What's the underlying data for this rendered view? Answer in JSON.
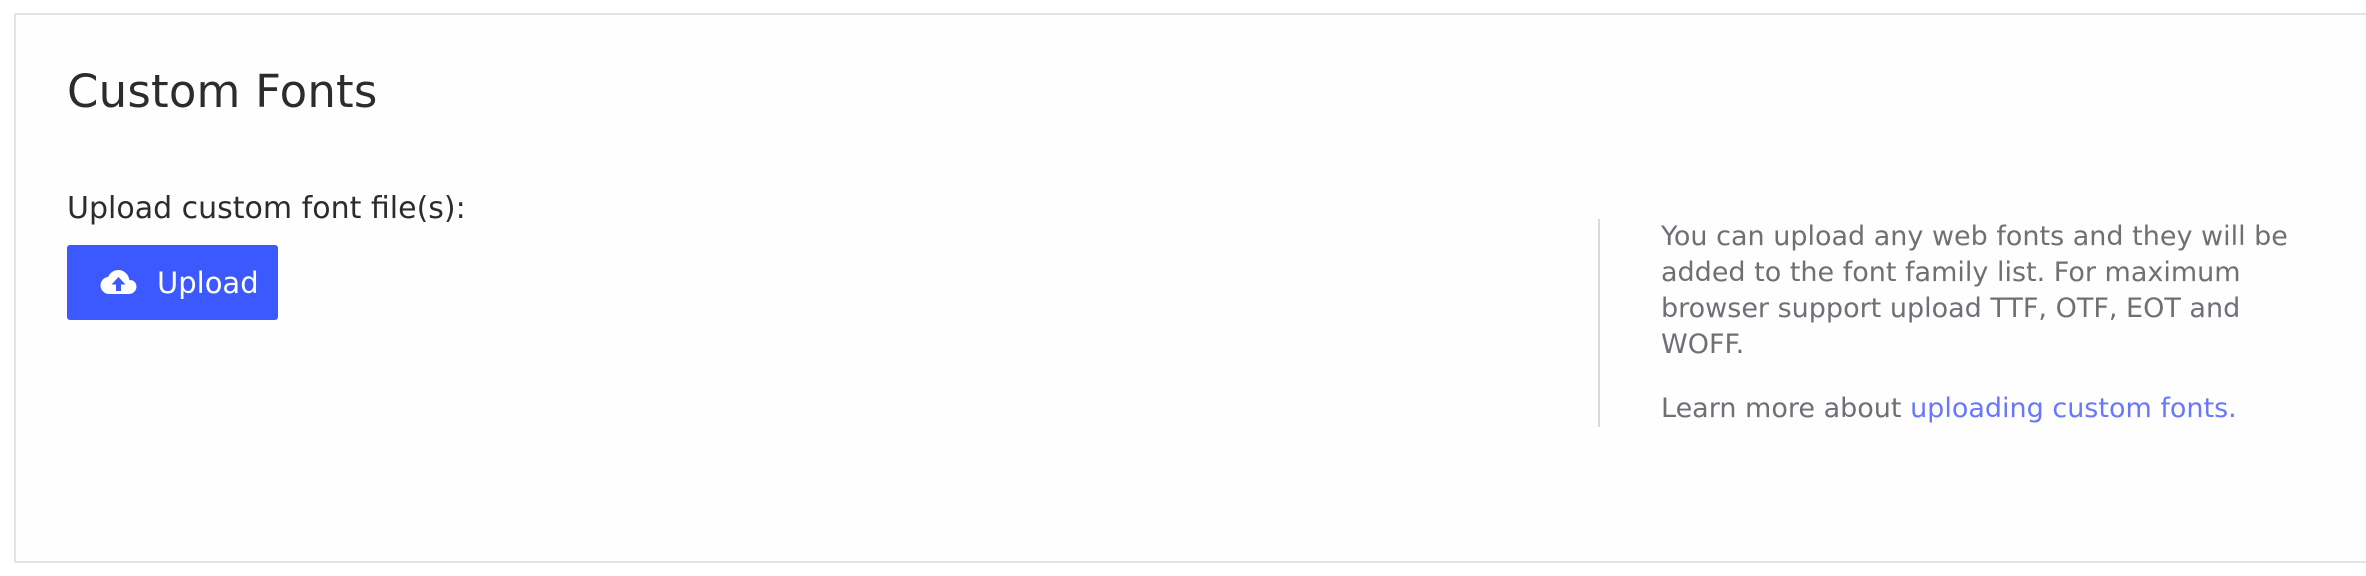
{
  "section": {
    "title": "Custom Fonts"
  },
  "upload": {
    "label": "Upload custom font file(s):",
    "button_label": "Upload",
    "button_icon": "cloud-upload-icon",
    "button_color": "#3c58ff"
  },
  "help": {
    "description": "You can upload any web fonts and they will be added to the font family list. For maximum browser support upload TTF, OTF, EOT and WOFF.",
    "learn_prefix": "Learn more about",
    "learn_link": "uploading custom fonts.",
    "link_color": "#6877ff"
  }
}
